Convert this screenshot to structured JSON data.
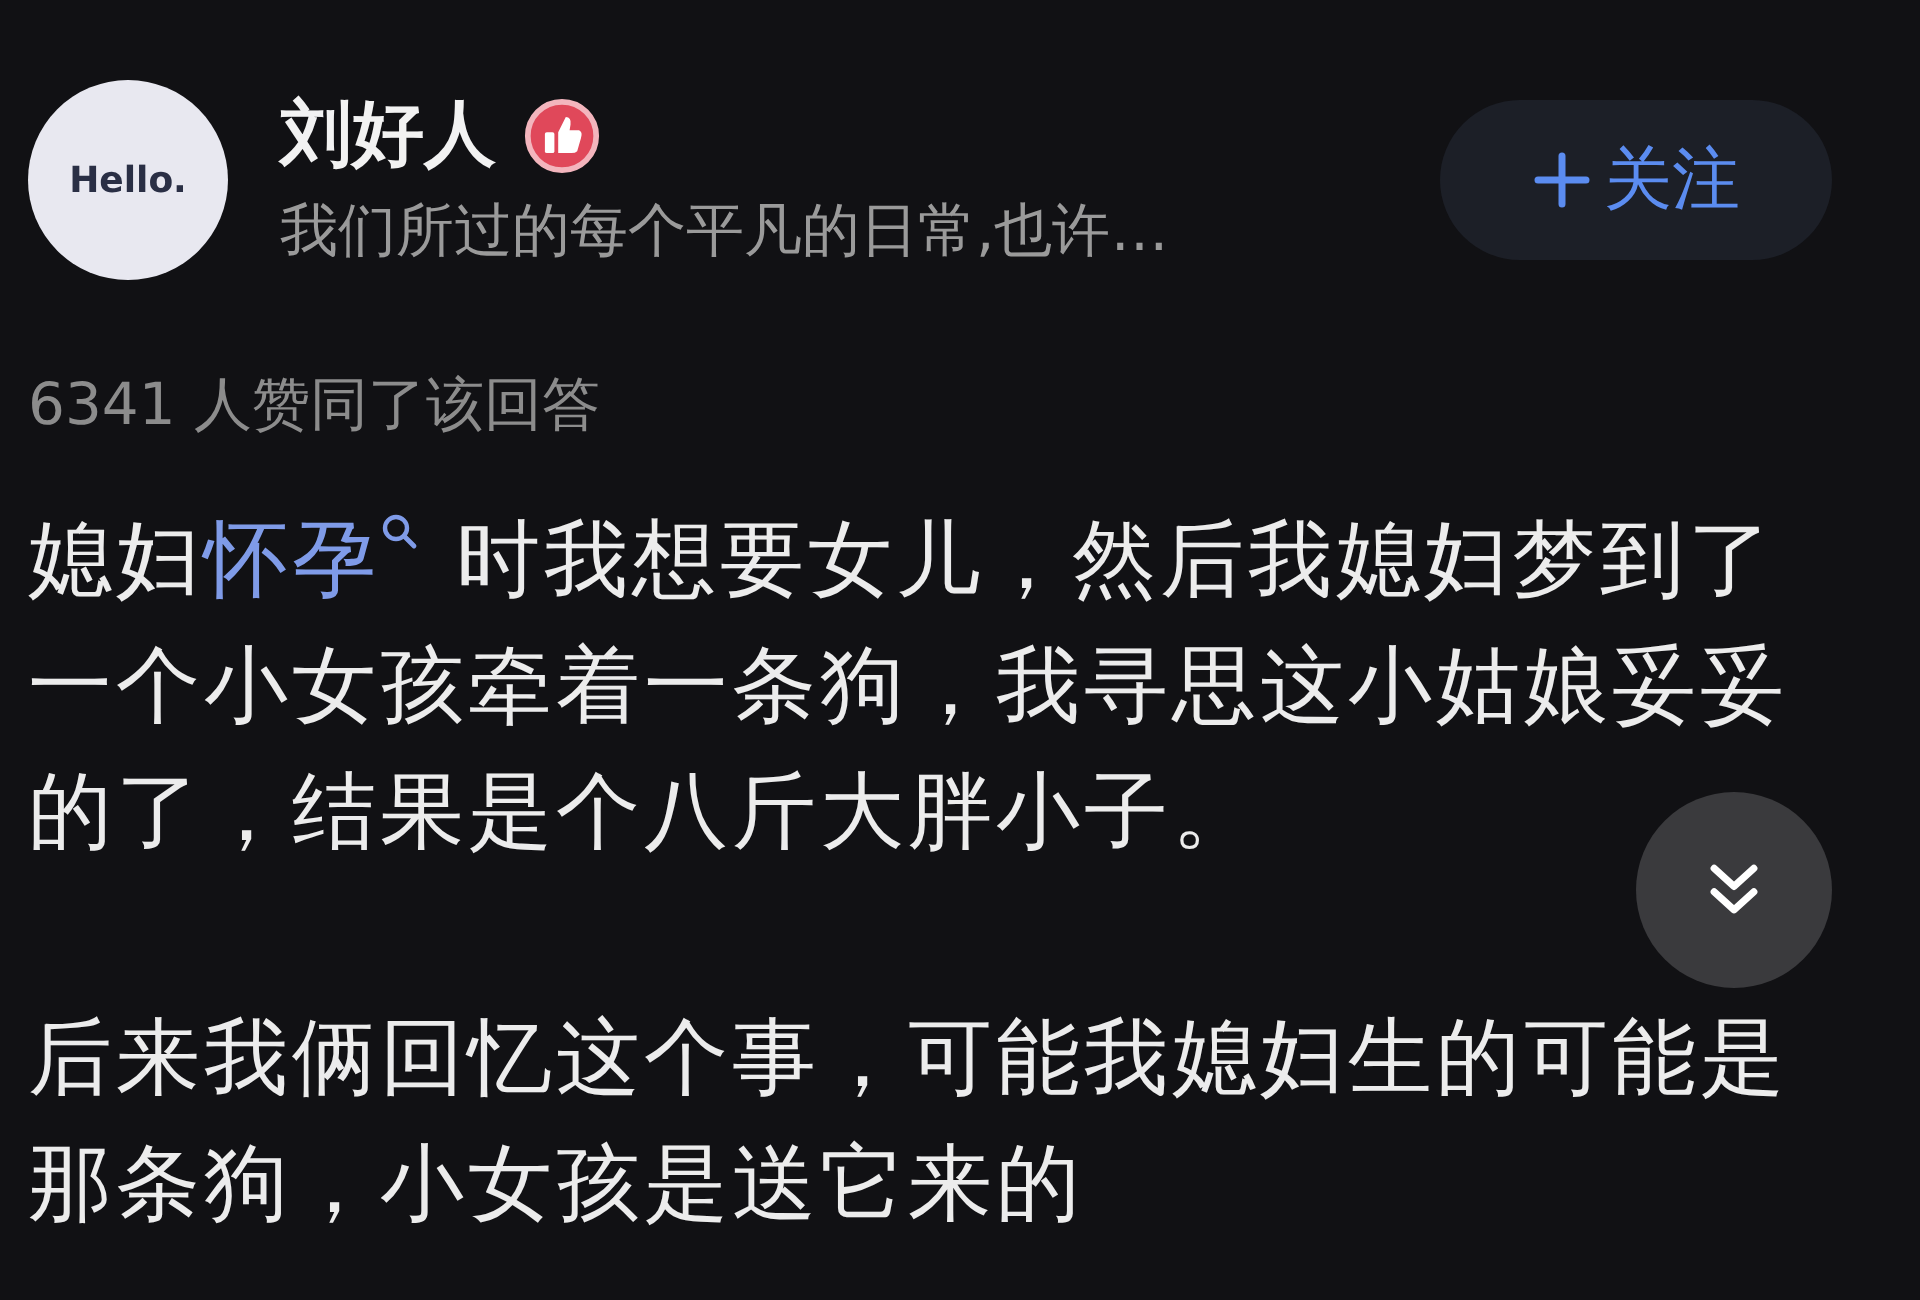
{
  "author": {
    "avatar_text": "Hello.",
    "name": "刘好人",
    "bio": "我们所过的每个平凡的日常,也许…"
  },
  "follow_button": {
    "label": "关注"
  },
  "upvote_summary": "6341 人赞同了该回答",
  "paragraphs": [
    {
      "segments": [
        {
          "kind": "text",
          "text": "媳妇"
        },
        {
          "kind": "search_link",
          "text": "怀孕"
        },
        {
          "kind": "text",
          "text": "时我想要女儿，然后我媳妇梦到了一个小女孩牵着一条狗，我寻思这小姑娘妥妥的了，结果是个八斤大胖小子。"
        }
      ]
    },
    {
      "segments": [
        {
          "kind": "text",
          "text": "后来我俩回忆这个事，可能我媳妇生的可能是那条狗，小女孩是送它来的"
        }
      ]
    }
  ]
}
